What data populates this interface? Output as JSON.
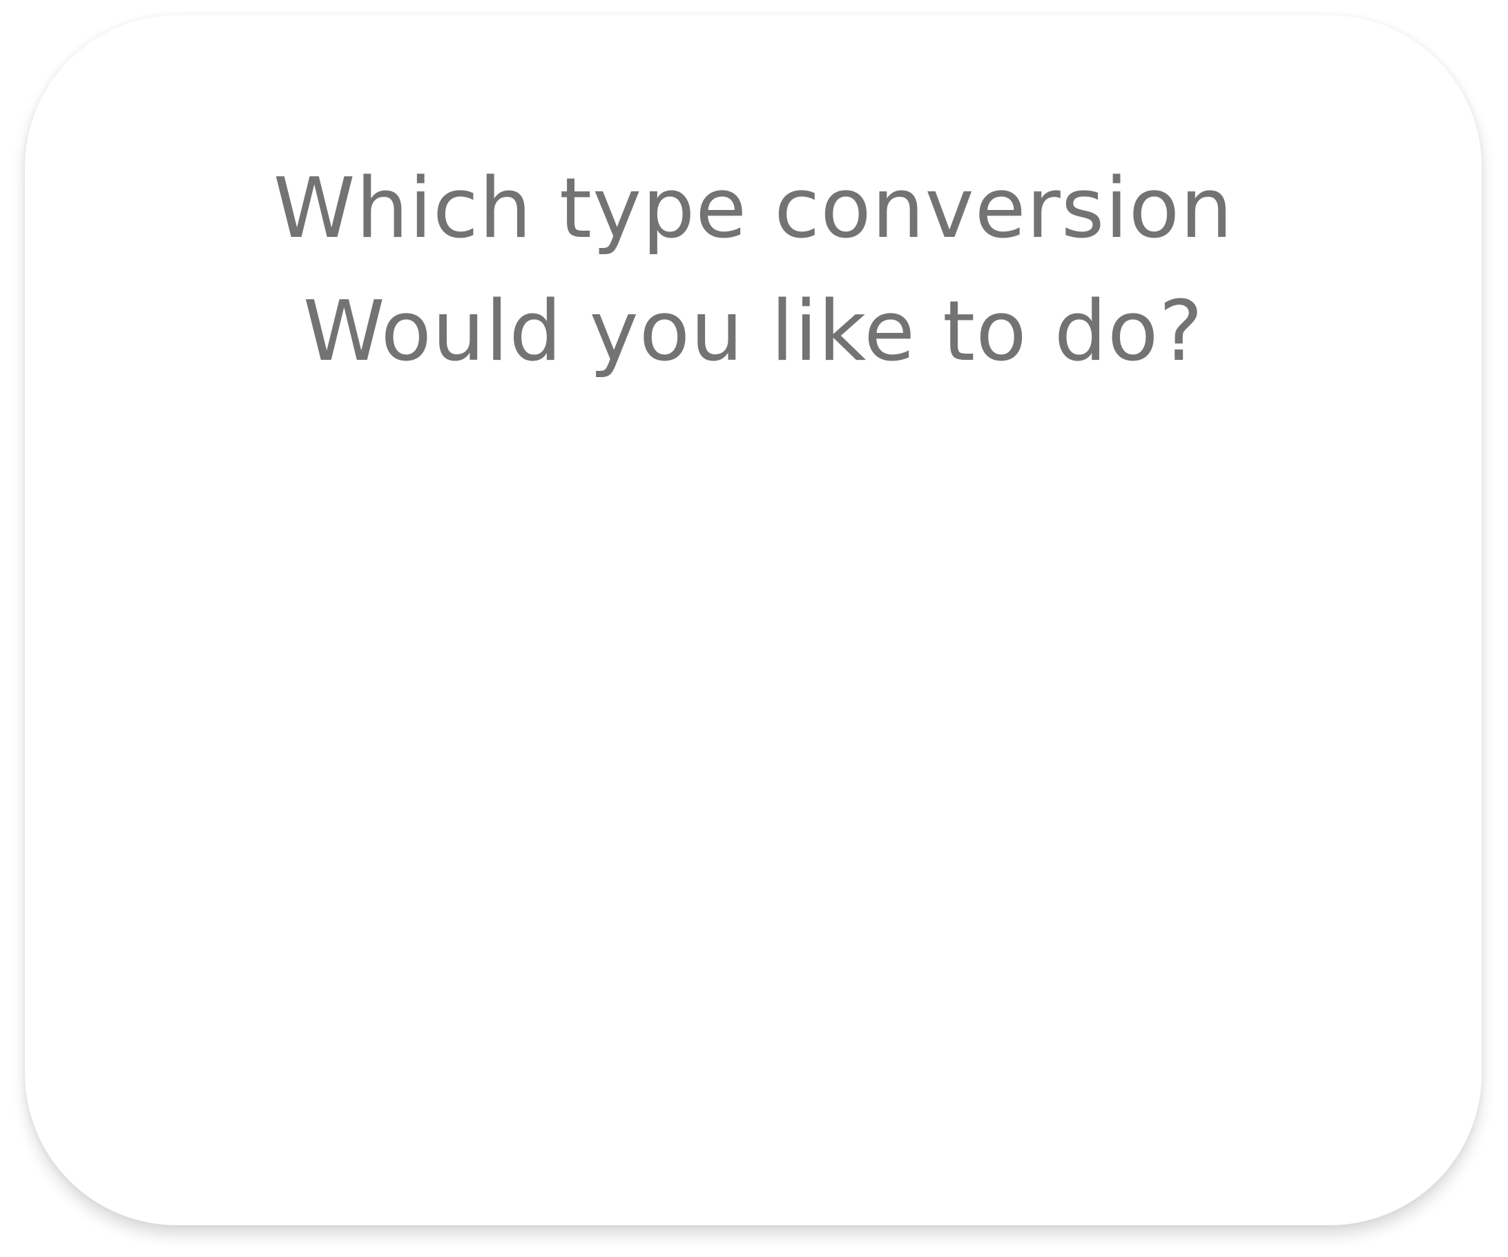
{
  "dialog": {
    "question": "Which type conversion Would you like to do?"
  },
  "colors": {
    "card_background": "#ffffff",
    "question_text": "#737373"
  }
}
